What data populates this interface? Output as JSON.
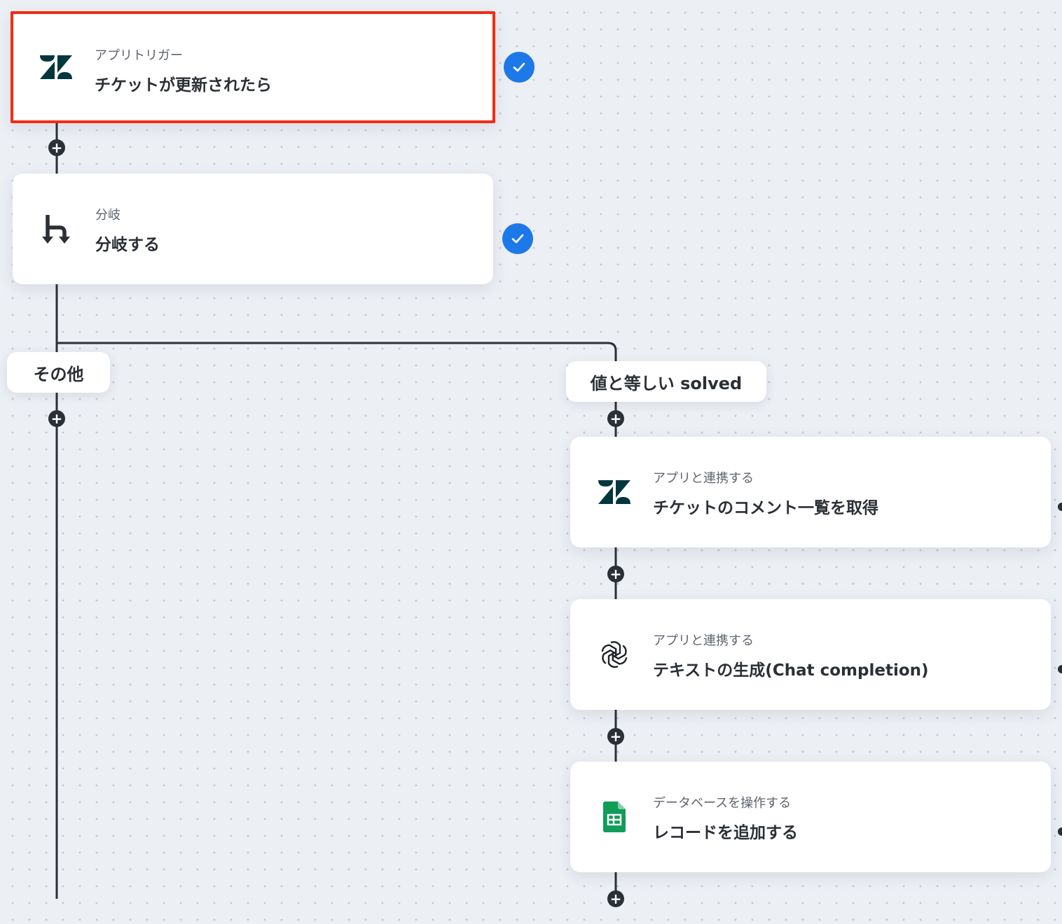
{
  "flow": {
    "trigger": {
      "subtitle": "アプリトリガー",
      "title": "チケットが更新されたら",
      "icon": "zendesk-icon",
      "status": "completed"
    },
    "branch": {
      "subtitle": "分岐",
      "title": "分岐する",
      "icon": "branch-icon",
      "status": "completed"
    },
    "branches": {
      "other_label": "その他",
      "match_label": "値と等しい solved"
    },
    "steps": [
      {
        "subtitle": "アプリと連携する",
        "title": "チケットのコメント一覧を取得",
        "icon": "zendesk-icon"
      },
      {
        "subtitle": "アプリと連携する",
        "title": "テキストの生成(Chat completion)",
        "icon": "openai-icon"
      },
      {
        "subtitle": "データベースを操作する",
        "title": "レコードを追加する",
        "icon": "google-sheets-icon"
      }
    ]
  },
  "colors": {
    "accent": "#1d79e8",
    "selected_border": "#f22c14",
    "zendesk": "#03363d",
    "sheets": "#0f9d58",
    "line": "#2b2f36"
  },
  "icons": {
    "plus": "+"
  }
}
